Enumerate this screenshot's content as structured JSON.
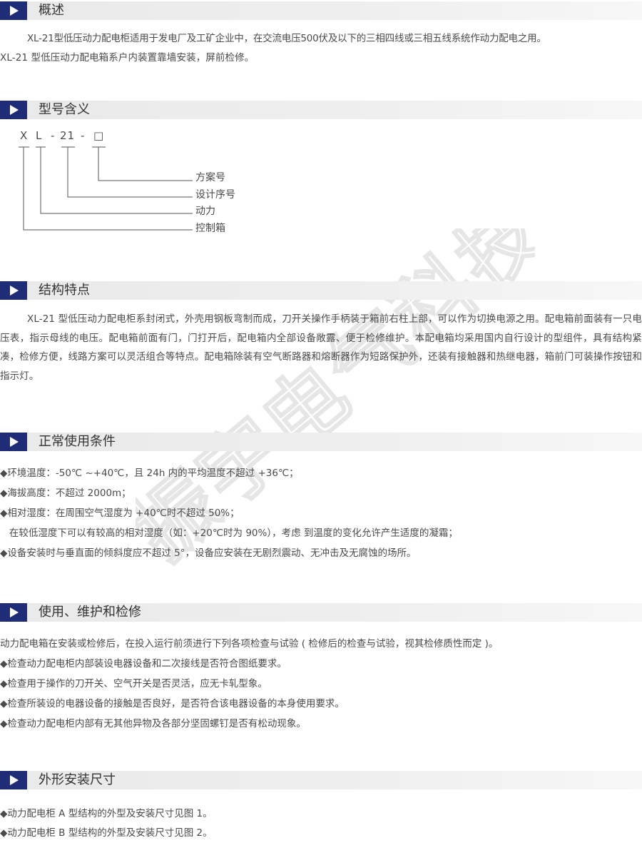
{
  "sections": {
    "overview": {
      "title": "概述",
      "paragraphs": [
        "XL-21型低压动力配电柜适用于发电厂及工矿企业中，在交流电压500伏及以下的三相四线或三相五线系统作动力配电之用。",
        "XL-21 型低压动力配电箱系户内装置靠墙安装，屏前检修。"
      ]
    },
    "model_meaning": {
      "title": "型号含义",
      "code": [
        "X",
        "L",
        "-",
        "21",
        "-",
        "□"
      ],
      "labels": [
        "方案号",
        "设计序号",
        "动力",
        "控制箱"
      ]
    },
    "structure": {
      "title": "结构特点",
      "paragraph": "XL-21 型低压动力配电柜系封闭式，外壳用钢板弯制而成，刀开关操作手柄装于箱前右柱上部，可以作为切换电源之用。配电箱前面装有一只电压表，指示母线的电压。配电箱前面有门，门打开后，配电箱内全部设备敞露、便于检修维护。本配电箱均采用国内自行设计的型组件，具有结构紧凑，检修方便，线路方案可以灵活组合等特点。配电箱除装有空气断路器和熔断器作为短路保护外，还装有接触器和热继电器，箱前门可装操作按钮和指示灯。"
    },
    "conditions": {
      "title": "正常使用条件",
      "lines": [
        "◆环境温度：-50℃ ~+40℃，且 24h 内的平均温度不超过 +36℃；",
        "◆海拔高度：不超过 2000m；",
        "◆相对湿度：在周围空气湿度为 +40℃时不超过 50%；",
        "   在较低湿度下可以有较高的相对湿度（如：+20℃时为 90%），考虑 到温度的变化允许产生适度的凝霜；",
        "◆设备安装时与垂直面的倾斜度应不超过 5°，设备应安装在无剧烈震动、无冲击及无腐蚀的场所。"
      ]
    },
    "maintenance": {
      "title": "使用、维护和检修",
      "lines": [
        "动力配电箱在安装或检修后，在投入运行前须进行下列各项检查与试验 ( 检修后的检查与试验，视其检修质性而定 )。",
        "◆检查动力配电柜内部装设电器设备和二次接线是否符合图纸要求。",
        "◆检查用于操作的刀开关、空气开关是否灵活，应无卡轧型象。",
        "◆检查所装设的电器设备的接触是否良好，是否符合该电器设备的本身使用要求。",
        "◆检查动力配电柜内部有无其他异物及各部分坚固螺钉是否有松动现象。"
      ]
    },
    "dimensions": {
      "title": "外形安装尺寸",
      "lines": [
        "◆动力配电柜 A 型结构的外型及安装尺寸见图 1。",
        "◆动力配电柜 B 型结构的外型及安装尺寸见图 2。"
      ]
    }
  },
  "watermark_text": "振宇电气科技",
  "colors": {
    "marker": "#1f2d78",
    "header_bg": "#ececec",
    "text": "#4a4a4a"
  }
}
